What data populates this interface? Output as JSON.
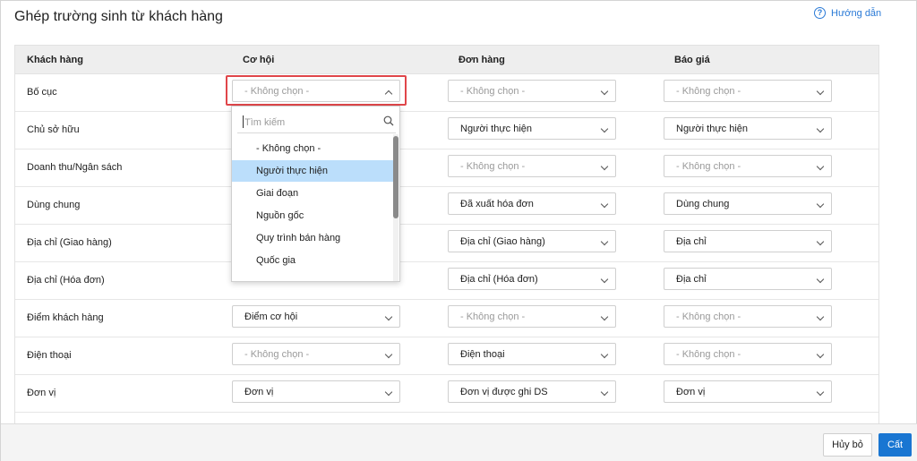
{
  "dialog": {
    "title": "Ghép trường sinh từ khách hàng",
    "help_label": "Hướng dẫn"
  },
  "table": {
    "headers": [
      "Khách hàng",
      "Cơ hội",
      "Đơn hàng",
      "Báo giá"
    ],
    "rows": [
      {
        "label": "Bố cục",
        "c1": "- Không chọn -",
        "c2": "- Không chọn -",
        "c3": "- Không chọn -"
      },
      {
        "label": "Chủ sở hữu",
        "c1": "",
        "c2": "Người thực hiện",
        "c3": "Người thực hiện"
      },
      {
        "label": "Doanh thu/Ngân sách",
        "c1": "",
        "c2": "- Không chọn -",
        "c3": "- Không chọn -"
      },
      {
        "label": "Dùng chung",
        "c1": "",
        "c2": "Đã xuất hóa đơn",
        "c3": "Dùng chung"
      },
      {
        "label": "Địa chỉ (Giao hàng)",
        "c1": "",
        "c2": "Địa chỉ (Giao hàng)",
        "c3": "Địa chỉ"
      },
      {
        "label": "Địa chỉ (Hóa đơn)",
        "c1": "",
        "c2": "Địa chỉ (Hóa đơn)",
        "c3": "Địa chỉ"
      },
      {
        "label": "Điểm khách hàng",
        "c1": "Điểm cơ hội",
        "c2": "- Không chọn -",
        "c3": "- Không chọn -"
      },
      {
        "label": "Điện thoại",
        "c1": "- Không chọn -",
        "c2": "Điện thoại",
        "c3": "- Không chọn -"
      },
      {
        "label": "Đơn vị",
        "c1": "Đơn vị",
        "c2": "Đơn vị được ghi DS",
        "c3": "Đơn vị"
      }
    ]
  },
  "dropdown": {
    "search_placeholder": "Tìm kiếm",
    "options": [
      "- Không chọn -",
      "Người thực hiện",
      "Giai đoạn",
      "Nguồn gốc",
      "Quy trình bán hàng",
      "Quốc gia"
    ],
    "selected": "Người thực hiện"
  },
  "footer": {
    "cancel_label": "Hủy bỏ",
    "save_label": "Cất"
  },
  "colors": {
    "accent": "#1976d2",
    "highlight": "#e0464a",
    "selected_option": "#bbdefb"
  }
}
